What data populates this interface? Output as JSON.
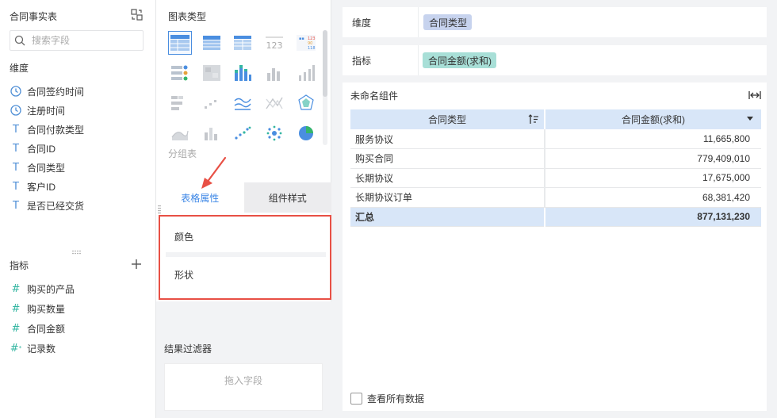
{
  "left": {
    "title": "合同事实表",
    "search_placeholder": "搜索字段",
    "dimensions_label": "维度",
    "dimensions": [
      {
        "type": "time",
        "label": "合同签约时间"
      },
      {
        "type": "time",
        "label": "注册时间"
      },
      {
        "type": "text",
        "label": "合同付款类型"
      },
      {
        "type": "text",
        "label": "合同ID"
      },
      {
        "type": "text",
        "label": "合同类型"
      },
      {
        "type": "text",
        "label": "客户ID"
      },
      {
        "type": "text",
        "label": "是否已经交货"
      }
    ],
    "measures_label": "指标",
    "measures": [
      {
        "type": "number",
        "label": "购买的产品"
      },
      {
        "type": "number",
        "label": "购买数量"
      },
      {
        "type": "number",
        "label": "合同金额"
      },
      {
        "type": "count",
        "label": "记录数"
      }
    ]
  },
  "middle": {
    "chart_type_label": "图表类型",
    "group_label": "分组表",
    "tabs": [
      "表格属性",
      "组件样式"
    ],
    "properties": [
      "颜色",
      "形状"
    ],
    "filter_title": "结果过滤器",
    "filter_placeholder": "拖入字段",
    "icons": {
      "arrow_color": "#e85045",
      "highlight_color": "#e85045"
    }
  },
  "right": {
    "dimension_shelf_label": "维度",
    "dimension_pill": "合同类型",
    "measure_shelf_label": "指标",
    "measure_pill": "合同金额(求和)",
    "widget_title": "未命名组件",
    "table": {
      "headers": [
        "合同类型",
        "合同金额(求和)"
      ],
      "rows": [
        [
          "服务协议",
          "11,665,800"
        ],
        [
          "购买合同",
          "779,409,010"
        ],
        [
          "长期协议",
          "17,675,000"
        ],
        [
          "长期协议订单",
          "68,381,420"
        ]
      ],
      "total": [
        "汇总",
        "877,131,230"
      ]
    },
    "show_all_label": "查看所有数据"
  },
  "colors": {
    "accent": "#3b86e6",
    "dimension_pill": "#c7d3ee",
    "measure_pill": "#a8dfd7",
    "table_header": "#d8e6f8"
  }
}
